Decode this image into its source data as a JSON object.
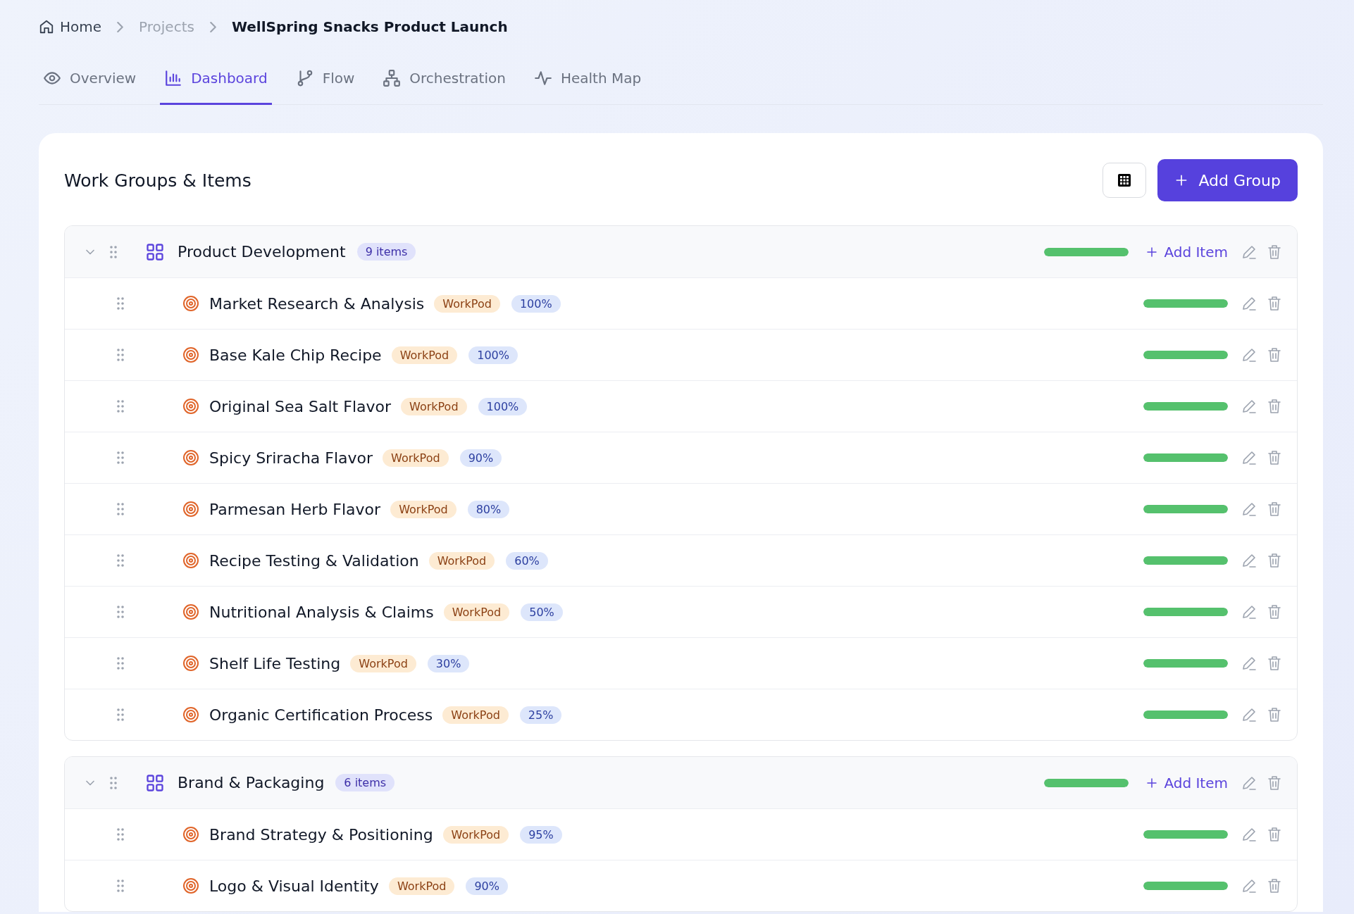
{
  "breadcrumb": [
    {
      "label": "Home",
      "kind": "home"
    },
    {
      "label": "Projects",
      "kind": "link"
    },
    {
      "label": "WellSpring Snacks Product Launch",
      "kind": "current"
    }
  ],
  "tabs": [
    {
      "label": "Overview",
      "kind": "eye",
      "selected": false
    },
    {
      "label": "Dashboard",
      "kind": "chart",
      "selected": true
    },
    {
      "label": "Flow",
      "kind": "branch",
      "selected": false
    },
    {
      "label": "Orchestration",
      "kind": "hierarchy",
      "selected": false
    },
    {
      "label": "Health Map",
      "kind": "pulse",
      "selected": false
    }
  ],
  "panel": {
    "title": "Work Groups & Items",
    "add_button": "Add Group"
  },
  "groups": [
    {
      "name": "Product Development",
      "count": "9 items",
      "expanded": true,
      "level": 1,
      "add_item": "Add Item",
      "items": [
        {
          "name": "Market Research & Analysis",
          "tag": "WorkPod",
          "percent": "100%",
          "level": 1
        },
        {
          "name": "Base Kale Chip Recipe",
          "tag": "WorkPod",
          "percent": "100%",
          "level": 1
        },
        {
          "name": "Original Sea Salt Flavor",
          "tag": "WorkPod",
          "percent": "100%",
          "level": 1
        },
        {
          "name": "Spicy Sriracha Flavor",
          "tag": "WorkPod",
          "percent": "90%",
          "level": 1
        },
        {
          "name": "Parmesan Herb Flavor",
          "tag": "WorkPod",
          "percent": "80%",
          "level": 1
        },
        {
          "name": "Recipe Testing & Validation",
          "tag": "WorkPod",
          "percent": "60%",
          "level": 1
        },
        {
          "name": "Nutritional Analysis & Claims",
          "tag": "WorkPod",
          "percent": "50%",
          "level": 1
        },
        {
          "name": "Shelf Life Testing",
          "tag": "WorkPod",
          "percent": "30%",
          "level": 1
        },
        {
          "name": "Organic Certification Process",
          "tag": "WorkPod",
          "percent": "25%",
          "level": 1
        }
      ]
    },
    {
      "name": "Brand & Packaging",
      "count": "6 items",
      "expanded": true,
      "level": 1,
      "add_item": "Add Item",
      "items": [
        {
          "name": "Brand Strategy & Positioning",
          "tag": "WorkPod",
          "percent": "95%",
          "level": 1
        },
        {
          "name": "Logo & Visual Identity",
          "tag": "WorkPod",
          "percent": "90%",
          "level": 1
        }
      ]
    }
  ]
}
